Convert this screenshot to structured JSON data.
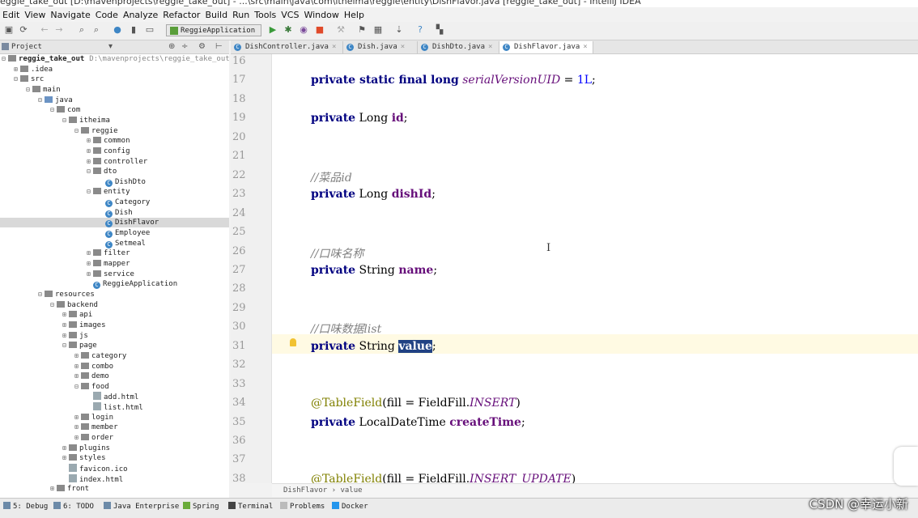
{
  "window": {
    "title": "eggie_take_out [D:\\mavenprojects\\reggie_take_out] - ...\\src\\main\\java\\com\\itheima\\reggie\\entity\\DishFlavor.java [reggie_take_out] - IntelliJ IDEA"
  },
  "menu": [
    "Edit",
    "View",
    "Navigate",
    "Code",
    "Analyze",
    "Refactor",
    "Build",
    "Run",
    "Tools",
    "VCS",
    "Window",
    "Help"
  ],
  "toolbar": {
    "run_config": "ReggieApplication"
  },
  "project_panel": {
    "title": "Project"
  },
  "tree": [
    {
      "label": "reggie_take_out",
      "extra": "D:\\mavenprojects\\reggie_take_out",
      "depth": 0,
      "fold": "−",
      "icon": "folder",
      "bold": true
    },
    {
      "label": ".idea",
      "depth": 1,
      "fold": "+",
      "icon": "folder"
    },
    {
      "label": "src",
      "depth": 1,
      "fold": "−",
      "icon": "folder"
    },
    {
      "label": "main",
      "depth": 2,
      "fold": "−",
      "icon": "folder"
    },
    {
      "label": "java",
      "depth": 3,
      "fold": "−",
      "icon": "folder-blue"
    },
    {
      "label": "com",
      "depth": 4,
      "fold": "−",
      "icon": "folder"
    },
    {
      "label": "itheima",
      "depth": 5,
      "fold": "−",
      "icon": "folder"
    },
    {
      "label": "reggie",
      "depth": 6,
      "fold": "−",
      "icon": "folder"
    },
    {
      "label": "common",
      "depth": 7,
      "fold": "+",
      "icon": "folder"
    },
    {
      "label": "config",
      "depth": 7,
      "fold": "+",
      "icon": "folder"
    },
    {
      "label": "controller",
      "depth": 7,
      "fold": "+",
      "icon": "folder"
    },
    {
      "label": "dto",
      "depth": 7,
      "fold": "−",
      "icon": "folder"
    },
    {
      "label": "DishDto",
      "depth": 8,
      "fold": "",
      "icon": "class"
    },
    {
      "label": "entity",
      "depth": 7,
      "fold": "−",
      "icon": "folder"
    },
    {
      "label": "Category",
      "depth": 8,
      "fold": "",
      "icon": "class"
    },
    {
      "label": "Dish",
      "depth": 8,
      "fold": "",
      "icon": "class"
    },
    {
      "label": "DishFlavor",
      "depth": 8,
      "fold": "",
      "icon": "class",
      "selected": true
    },
    {
      "label": "Employee",
      "depth": 8,
      "fold": "",
      "icon": "class"
    },
    {
      "label": "Setmeal",
      "depth": 8,
      "fold": "",
      "icon": "class"
    },
    {
      "label": "filter",
      "depth": 7,
      "fold": "+",
      "icon": "folder"
    },
    {
      "label": "mapper",
      "depth": 7,
      "fold": "+",
      "icon": "folder"
    },
    {
      "label": "service",
      "depth": 7,
      "fold": "+",
      "icon": "folder"
    },
    {
      "label": "ReggieApplication",
      "depth": 7,
      "fold": "",
      "icon": "class"
    },
    {
      "label": "resources",
      "depth": 3,
      "fold": "−",
      "icon": "folder"
    },
    {
      "label": "backend",
      "depth": 4,
      "fold": "−",
      "icon": "folder"
    },
    {
      "label": "api",
      "depth": 5,
      "fold": "+",
      "icon": "folder"
    },
    {
      "label": "images",
      "depth": 5,
      "fold": "+",
      "icon": "folder"
    },
    {
      "label": "js",
      "depth": 5,
      "fold": "+",
      "icon": "folder"
    },
    {
      "label": "page",
      "depth": 5,
      "fold": "−",
      "icon": "folder"
    },
    {
      "label": "category",
      "depth": 6,
      "fold": "+",
      "icon": "folder"
    },
    {
      "label": "combo",
      "depth": 6,
      "fold": "+",
      "icon": "folder"
    },
    {
      "label": "demo",
      "depth": 6,
      "fold": "+",
      "icon": "folder"
    },
    {
      "label": "food",
      "depth": 6,
      "fold": "−",
      "icon": "folder"
    },
    {
      "label": "add.html",
      "depth": 7,
      "fold": "",
      "icon": "html"
    },
    {
      "label": "list.html",
      "depth": 7,
      "fold": "",
      "icon": "html"
    },
    {
      "label": "login",
      "depth": 6,
      "fold": "+",
      "icon": "folder"
    },
    {
      "label": "member",
      "depth": 6,
      "fold": "+",
      "icon": "folder"
    },
    {
      "label": "order",
      "depth": 6,
      "fold": "+",
      "icon": "folder"
    },
    {
      "label": "plugins",
      "depth": 5,
      "fold": "+",
      "icon": "folder"
    },
    {
      "label": "styles",
      "depth": 5,
      "fold": "+",
      "icon": "folder"
    },
    {
      "label": "favicon.ico",
      "depth": 5,
      "fold": "",
      "icon": "file"
    },
    {
      "label": "index.html",
      "depth": 5,
      "fold": "",
      "icon": "html"
    },
    {
      "label": "front",
      "depth": 4,
      "fold": "+",
      "icon": "folder"
    }
  ],
  "tabs": [
    {
      "label": "DishController.java",
      "active": false
    },
    {
      "label": "Dish.java",
      "active": false
    },
    {
      "label": "DishDto.java",
      "active": false
    },
    {
      "label": "DishFlavor.java",
      "active": true
    }
  ],
  "code_lines": [
    {
      "n": "16",
      "html": ""
    },
    {
      "n": "17",
      "html": "<span class=\"kw\">private static final long</span> <span class=\"st\">serialVersionUID</span> = <span class=\"num\">1L</span>;"
    },
    {
      "n": "18",
      "html": ""
    },
    {
      "n": "19",
      "html": "<span class=\"kw\">private</span> Long <span class=\"fld\">id</span>;"
    },
    {
      "n": "20",
      "html": ""
    },
    {
      "n": "21",
      "html": ""
    },
    {
      "n": "22",
      "html": "<span class=\"cm\">//菜品id</span>"
    },
    {
      "n": "23",
      "html": "<span class=\"kw\">private</span> Long <span class=\"fld\">dishId</span>;"
    },
    {
      "n": "24",
      "html": ""
    },
    {
      "n": "25",
      "html": ""
    },
    {
      "n": "26",
      "html": "<span class=\"cm\">//口味名称</span>"
    },
    {
      "n": "27",
      "html": "<span class=\"kw\">private</span> String <span class=\"fld\">name</span>;"
    },
    {
      "n": "28",
      "html": ""
    },
    {
      "n": "29",
      "html": ""
    },
    {
      "n": "30",
      "html": "<span class=\"cm\">//口味数据list</span>"
    },
    {
      "n": "31",
      "html": "<span class=\"kw\">private</span> String <span class=\"fld sel-word\">value</span>;"
    },
    {
      "n": "32",
      "html": ""
    },
    {
      "n": "33",
      "html": ""
    },
    {
      "n": "34",
      "html": "<span class=\"an\">@TableField</span>(fill = FieldFill.<span class=\"st\">INSERT</span>)"
    },
    {
      "n": "35",
      "html": "<span class=\"kw\">private</span> LocalDateTime <span class=\"fld\">createTime</span>;"
    },
    {
      "n": "36",
      "html": ""
    },
    {
      "n": "37",
      "html": ""
    },
    {
      "n": "38",
      "html": "<span class=\"an\">@TableField</span>(fill = FieldFill.<span class=\"st\">INSERT_UPDATE</span>)"
    }
  ],
  "breadcrumb": "DishFlavor  ›  value",
  "status_tabs": [
    {
      "label": "5: Debug"
    },
    {
      "label": "6: TODO"
    },
    {
      "label": "Java Enterprise"
    },
    {
      "label": "Spring"
    },
    {
      "label": "Terminal"
    },
    {
      "label": "Problems"
    },
    {
      "label": "Docker"
    }
  ],
  "watermark": "CSDN @幸运小新"
}
